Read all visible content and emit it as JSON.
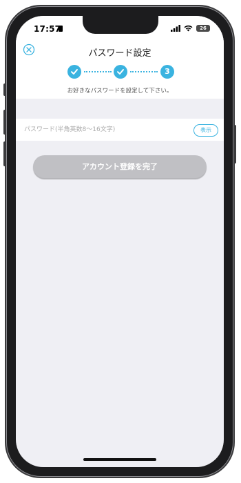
{
  "status_bar": {
    "time": "17:57",
    "battery": "26"
  },
  "header": {
    "title": "パスワード設定",
    "steps": [
      {
        "label": "",
        "state": "done"
      },
      {
        "label": "",
        "state": "done"
      },
      {
        "label": "3",
        "state": "current"
      }
    ],
    "subtitle": "お好きなパスワードを設定して下さい。"
  },
  "form": {
    "password_placeholder": "パスワード(半角英数8〜16文字)",
    "password_value": "",
    "show_label": "表示",
    "submit_label": "アカウント登録を完了"
  },
  "colors": {
    "accent": "#3ab3e0",
    "button_disabled": "#c0c0c4",
    "background": "#efeff4"
  },
  "icons": {
    "close": "close-circle-icon",
    "step_done": "check-icon"
  }
}
